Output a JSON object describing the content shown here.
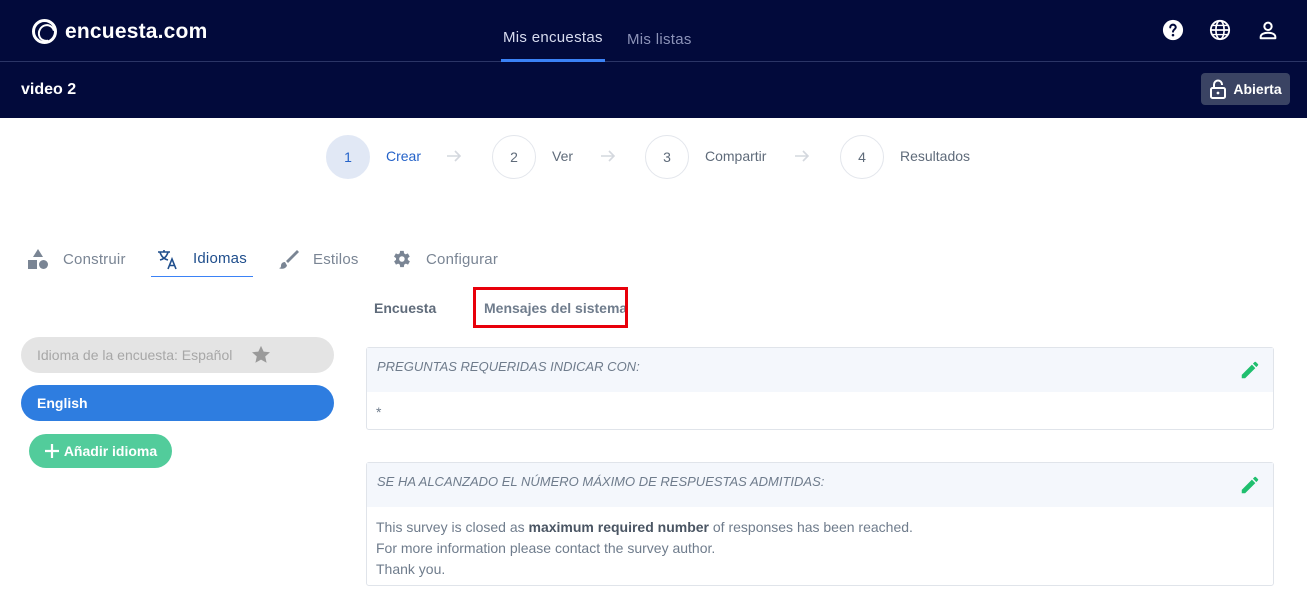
{
  "app": {
    "logo_text": "encuesta.com",
    "nav_tabs": [
      {
        "label": "Mis encuestas",
        "active": true
      },
      {
        "label": "Mis listas",
        "active": false
      }
    ],
    "icons": [
      "help-icon",
      "globe-icon",
      "user-icon"
    ]
  },
  "survey": {
    "title": "video 2",
    "status_label": "Abierta",
    "status_icon": "lock-open-icon"
  },
  "steps": [
    {
      "number": "1",
      "label": "Crear",
      "active": true
    },
    {
      "number": "2",
      "label": "Ver",
      "active": false
    },
    {
      "number": "3",
      "label": "Compartir",
      "active": false
    },
    {
      "number": "4",
      "label": "Resultados",
      "active": false
    }
  ],
  "tool_tabs": [
    {
      "label": "Construir",
      "icon": "shapes-icon",
      "active": false
    },
    {
      "label": "Idiomas",
      "icon": "translate-icon",
      "active": true
    },
    {
      "label": "Estilos",
      "icon": "brush-icon",
      "active": false
    },
    {
      "label": "Configurar",
      "icon": "gear-icon",
      "active": false
    }
  ],
  "sub_tabs": [
    {
      "label": "Encuesta",
      "active": false
    },
    {
      "label": "Mensajes del sistema",
      "active": true
    }
  ],
  "languages": {
    "default_label": "Idioma de la encuesta: Español",
    "items": [
      "English"
    ],
    "add_label": "Añadir idioma"
  },
  "messages": [
    {
      "title": "PREGUNTAS REQUERIDAS INDICAR CON:",
      "body": "*"
    },
    {
      "title": "SE HA ALCANZADO EL NÚMERO MÁXIMO DE RESPUESTAS ADMITIDAS:",
      "line1_pre": "This survey is closed as ",
      "line1_bold": "maximum required number",
      "line1_post": " of responses has been reached.",
      "line2": "For more information please contact the survey author.",
      "line3": "Thank you."
    }
  ],
  "colors": {
    "navbar": "#020a3b",
    "accent_blue": "#2e7de0",
    "add_green": "#52cc9b",
    "edit_green": "#1fbf6e",
    "highlight_red": "#e8000b"
  }
}
